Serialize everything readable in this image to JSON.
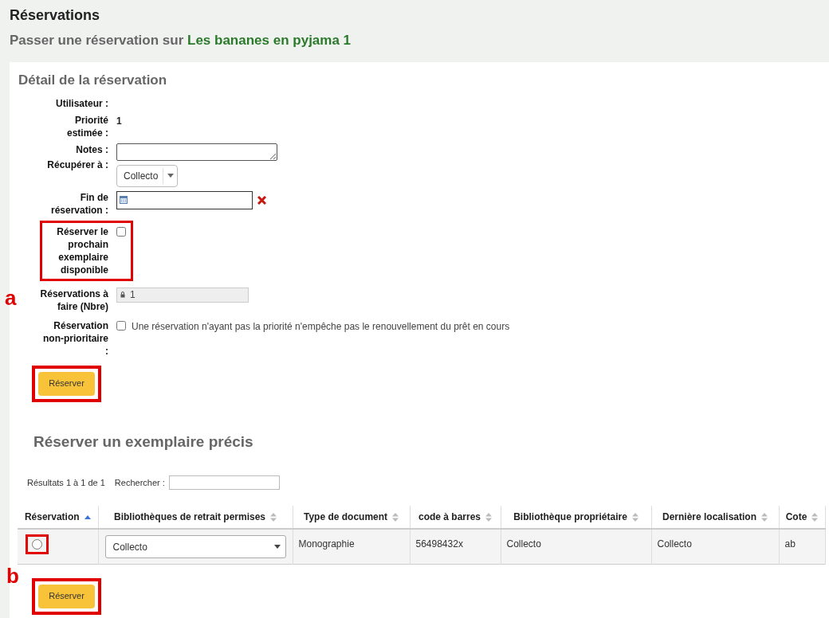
{
  "page": {
    "title": "Réservations",
    "subtitle_prefix": "Passer une réservation sur",
    "record_title": "Les bananes en pyjama 1"
  },
  "details": {
    "heading": "Détail de la réservation",
    "fields": [
      {
        "kind": "text",
        "label": "Utilisateur :"
      },
      {
        "kind": "text",
        "label": "Priorité estimée :",
        "value": "1"
      },
      {
        "kind": "textarea",
        "label": "Notes :"
      },
      {
        "kind": "select",
        "label": "Récupérer à :",
        "value": "Collecto"
      },
      {
        "kind": "date",
        "label": "Fin de réservation :"
      },
      {
        "kind": "checkbox",
        "label": "Réserver le prochain exemplaire disponible",
        "checked": false,
        "highlighted": true
      },
      {
        "kind": "locked",
        "label": "Réservations à faire (Nbre)",
        "value": "1",
        "marker": "a"
      },
      {
        "kind": "checkbox",
        "label": "Réservation non-prioritaire :",
        "checked": false,
        "text": "Une réservation n'ayant pas la priorité n'empêche pas le renouvellement du prêt en cours"
      }
    ],
    "submit": {
      "label": "Réserver",
      "highlighted": true
    }
  },
  "item_hold": {
    "heading": "Réserver un exemplaire précis",
    "info": "Résultats 1 à 1 de 1",
    "search_label": "Rechercher :",
    "columns": [
      {
        "label": "Réservation",
        "sorted": true
      },
      {
        "label": "Bibliothèques de retrait permises",
        "sorted": false
      },
      {
        "label": "Type de document",
        "sorted": false
      },
      {
        "label": "code à barres",
        "sorted": false
      },
      {
        "label": "Bibliothèque propriétaire",
        "sorted": false
      },
      {
        "label": "Dernière localisation",
        "sorted": false
      },
      {
        "label": "Cote",
        "sorted": false
      }
    ],
    "rows": [
      {
        "selected": false,
        "highlighted": true,
        "cells": [
          "",
          "Collecto",
          "Monographie",
          "56498432x",
          "Collecto",
          "Collecto",
          "ab"
        ]
      }
    ],
    "submit": {
      "label": "Réserver",
      "highlighted": true,
      "marker": "b"
    }
  }
}
